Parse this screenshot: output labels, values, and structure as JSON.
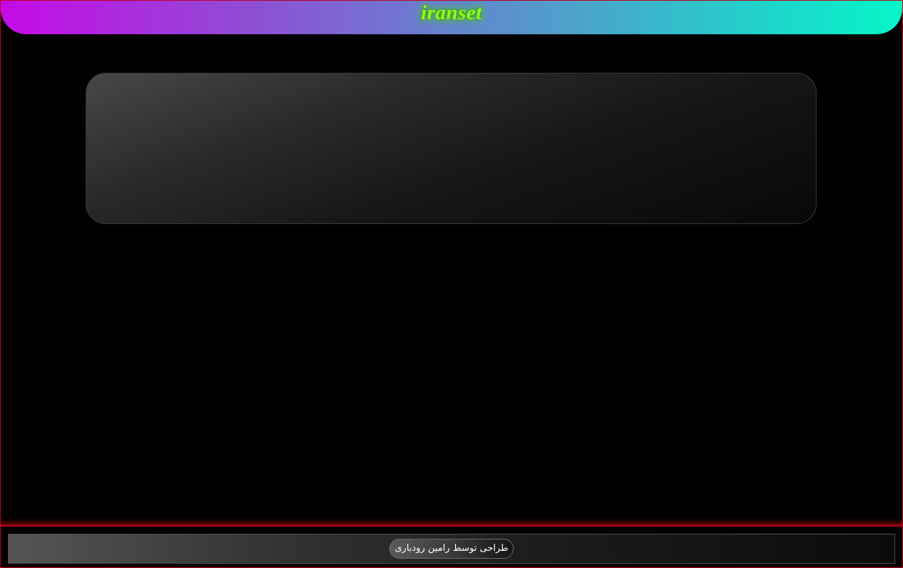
{
  "header": {
    "title": "iranset"
  },
  "footer": {
    "credit": "طراحی توسط رامین رودباری"
  },
  "colors": {
    "page_background": "#000000",
    "header_gradient_start": "#c50ae6",
    "header_gradient_end": "#05f6c8",
    "title_color": "#8cff1a",
    "frame_border": "#c0001a"
  }
}
